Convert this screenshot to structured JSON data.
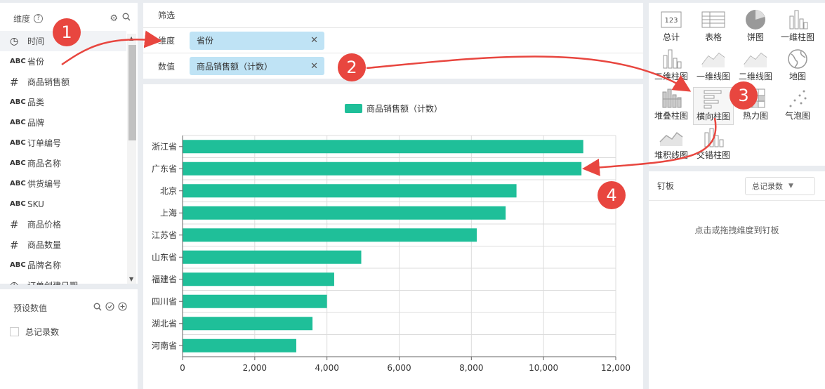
{
  "dims": {
    "title": "维度",
    "help": "?",
    "items": [
      {
        "type_icon": "clock",
        "label": "时间"
      },
      {
        "type_icon": "ABC",
        "label": "省份"
      },
      {
        "type_icon": "#",
        "label": "商品销售额"
      },
      {
        "type_icon": "ABC",
        "label": "品类"
      },
      {
        "type_icon": "ABC",
        "label": "品牌"
      },
      {
        "type_icon": "ABC",
        "label": "订单编号"
      },
      {
        "type_icon": "ABC",
        "label": "商品名称"
      },
      {
        "type_icon": "ABC",
        "label": "供货编号"
      },
      {
        "type_icon": "ABC",
        "label": "SKU"
      },
      {
        "type_icon": "#",
        "label": "商品价格"
      },
      {
        "type_icon": "#",
        "label": "商品数量"
      },
      {
        "type_icon": "ABC",
        "label": "品牌名称"
      },
      {
        "type_icon": "clock",
        "label": "订单创建日期"
      }
    ]
  },
  "presets": {
    "title": "预设数值",
    "items": [
      {
        "label": "总记录数"
      }
    ]
  },
  "filters": {
    "filter_label": "筛选",
    "dimension_label": "维度",
    "dimension_chip": "省份",
    "value_label": "数值",
    "value_chip": "商品销售额（计数）"
  },
  "chart_types": [
    {
      "icon": "total-icon",
      "icon_text": "123",
      "label": "总计"
    },
    {
      "icon": "table-chart-icon",
      "label": "表格"
    },
    {
      "icon": "pie-chart-icon",
      "label": "饼图"
    },
    {
      "icon": "bar-chart-icon",
      "label": "一维柱图"
    },
    {
      "icon": "bar-chart-icon",
      "label": "二维柱图"
    },
    {
      "icon": "line-chart-icon",
      "label": "一维线图"
    },
    {
      "icon": "line-chart-icon",
      "label": "二维线图"
    },
    {
      "icon": "globe-map-icon",
      "label": "地图"
    },
    {
      "icon": "stacked-bar-icon",
      "label": "堆叠柱图"
    },
    {
      "icon": "horizontal-bar-icon",
      "label": "横向柱图"
    },
    {
      "icon": "heatmap-icon",
      "label": "热力图"
    },
    {
      "icon": "bubble-chart-icon",
      "label": "气泡图"
    },
    {
      "icon": "stacked-line-icon",
      "label": "堆积线图"
    },
    {
      "icon": "cross-bar-icon",
      "label": "交错柱图"
    }
  ],
  "pin": {
    "title": "钉板",
    "select_value": "总记录数",
    "hint": "点击或拖拽维度到钉板"
  },
  "annotations": [
    "1",
    "2",
    "3",
    "4"
  ],
  "colors": {
    "bar": "#1fbf99",
    "chip": "#bfe3f5",
    "annotation": "#e8463f",
    "selected_type": "#f6f6f6"
  },
  "chart_data": {
    "type": "bar",
    "orientation": "horizontal",
    "categories": [
      "浙江省",
      "广东省",
      "北京",
      "上海",
      "江苏省",
      "山东省",
      "福建省",
      "四川省",
      "湖北省",
      "河南省"
    ],
    "series": [
      {
        "name": "商品销售额（计数）",
        "values": [
          11100,
          11050,
          9250,
          8950,
          8150,
          4950,
          4200,
          4000,
          3600,
          3150
        ]
      }
    ],
    "xlim": [
      0,
      12000
    ],
    "x_ticks": [
      "0",
      "2,000",
      "4,000",
      "6,000",
      "8,000",
      "10,000",
      "12,000"
    ],
    "grid": true,
    "legend": "top-center"
  }
}
